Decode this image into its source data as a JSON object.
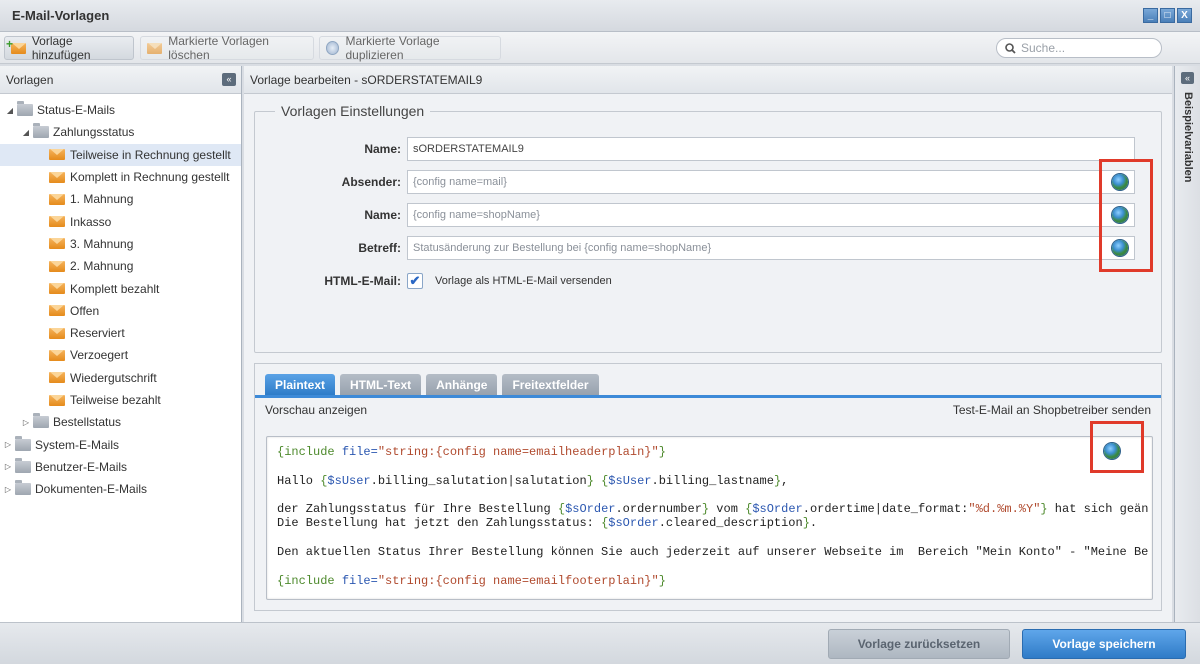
{
  "window": {
    "title": "E-Mail-Vorlagen",
    "controls": [
      "_",
      "□",
      "X"
    ]
  },
  "toolbar": {
    "add_label": "Vorlage hinzufügen",
    "delete_label": "Markierte Vorlagen löschen",
    "duplicate_label": "Markierte Vorlage duplizieren",
    "search_placeholder": "Suche..."
  },
  "sidebar": {
    "title": "Vorlagen",
    "collapse_glyph": "«",
    "tree": {
      "status_emails": "Status-E-Mails",
      "zahlungsstatus": "Zahlungsstatus",
      "zahlung_items": [
        "Teilweise in Rechnung gestellt",
        "Komplett in Rechnung gestellt",
        "1. Mahnung",
        "Inkasso",
        "3. Mahnung",
        "2. Mahnung",
        "Komplett bezahlt",
        "Offen",
        "Reserviert",
        "Verzoegert",
        "Wiedergutschrift",
        "Teilweise bezahlt"
      ],
      "bestellstatus": "Bestellstatus",
      "system_emails": "System-E-Mails",
      "benutzer_emails": "Benutzer-E-Mails",
      "dokumenten_emails": "Dokumenten-E-Mails"
    }
  },
  "editor": {
    "header": "Vorlage bearbeiten - sORDERSTATEMAIL9",
    "fieldset_title": "Vorlagen Einstellungen",
    "fields": {
      "name_label": "Name:",
      "name_value": "sORDERSTATEMAIL9",
      "sender_label": "Absender:",
      "sender_value": "{config name=mail}",
      "sender_name_label": "Name:",
      "sender_name_value": "{config name=shopName}",
      "subject_label": "Betreff:",
      "subject_value": "Statusänderung zur Bestellung bei {config name=shopName}",
      "html_label": "HTML-E-Mail:",
      "html_checkbox_label": "Vorlage als HTML-E-Mail versenden",
      "html_checked": "✔"
    },
    "tabs": [
      "Plaintext",
      "HTML-Text",
      "Anhänge",
      "Freitextfelder"
    ],
    "preview_label": "Vorschau anzeigen",
    "test_mail_label": "Test-E-Mail an Shopbetreiber senden",
    "code": {
      "l1": "{include file=\"string:{config name=emailheaderplain}\"}",
      "l2": "Hallo {$sUser.billing_salutation|salutation} {$sUser.billing_lastname},",
      "l3": "der Zahlungsstatus für Ihre Bestellung {$sOrder.ordernumber} vom {$sOrder.ordertime|date_format:\"%d.%m.%Y\"} hat sich geän",
      "l4": "Die Bestellung hat jetzt den Zahlungsstatus: {$sOrder.cleared_description}.",
      "l5": "Den aktuellen Status Ihrer Bestellung können Sie auch jederzeit auf unserer Webseite im  Bereich \"Mein Konto\" - \"Meine Be",
      "l6": "{include file=\"string:{config name=emailfooterplain}\"}"
    }
  },
  "right_panel": {
    "title": "Beispielvariablen",
    "collapse_glyph": "«"
  },
  "footer": {
    "reset_label": "Vorlage zurücksetzen",
    "save_label": "Vorlage speichern"
  },
  "colors": {
    "accent": "#2f7bc7",
    "highlight_box": "#e03a2a",
    "selected_row": "#dfe8f5"
  }
}
